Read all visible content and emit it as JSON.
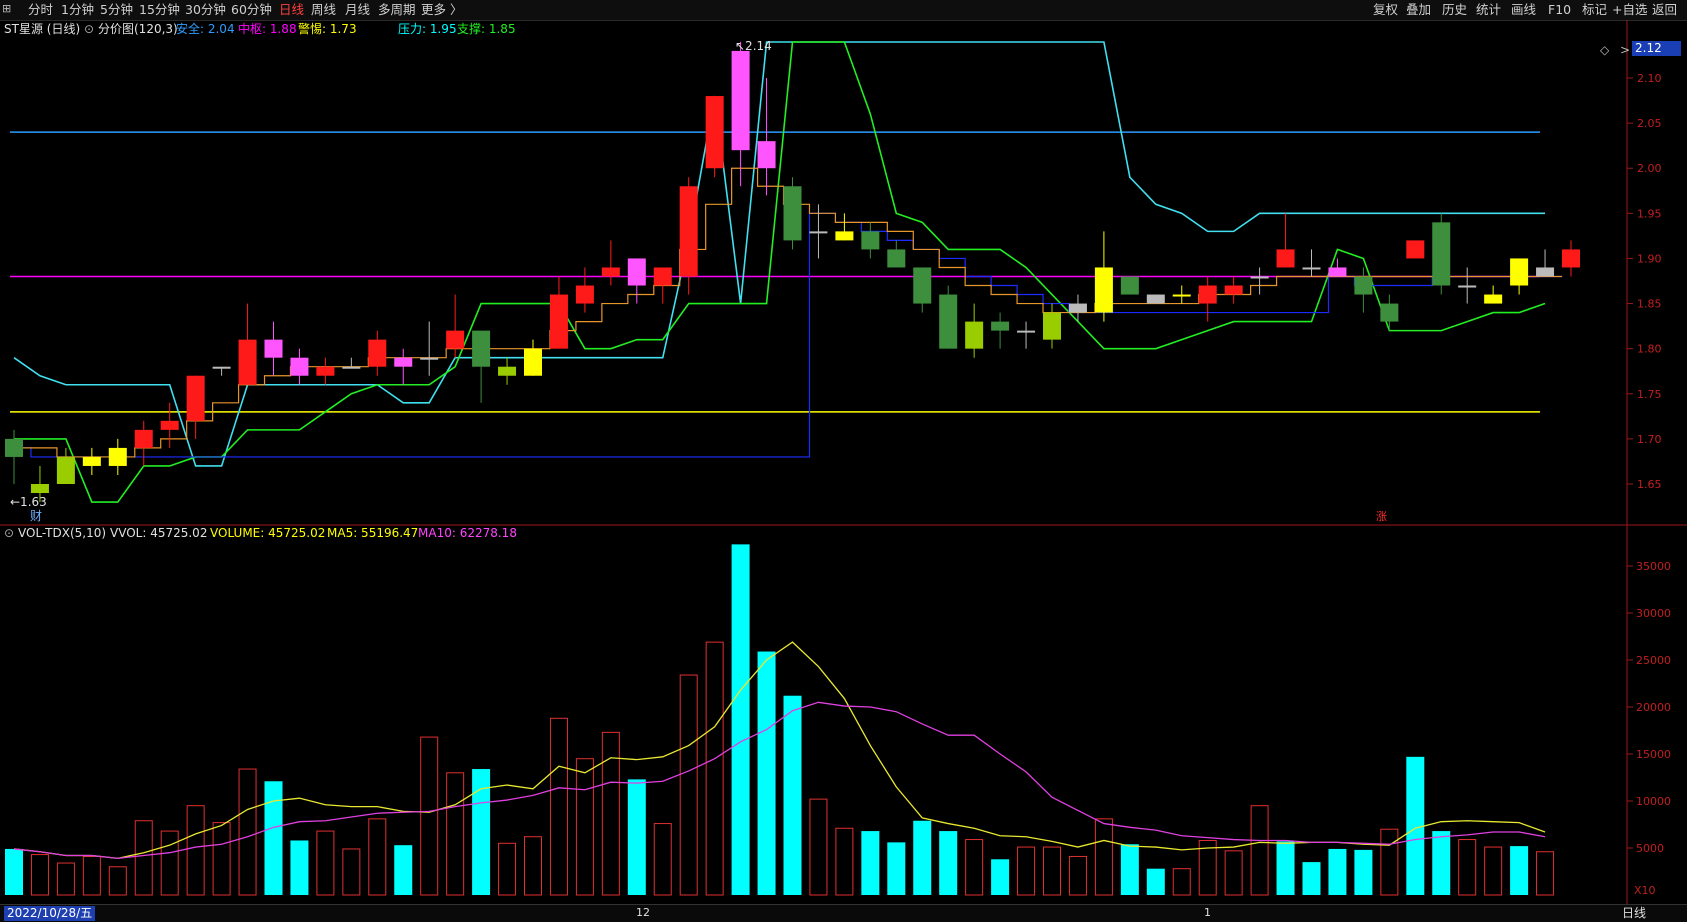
{
  "toolbar": {
    "periods": [
      {
        "label": "分时",
        "x": 0
      },
      {
        "label": "1分钟",
        "x": 0
      },
      {
        "label": "5分钟",
        "x": 0
      },
      {
        "label": "15分钟",
        "x": 0
      },
      {
        "label": "30分钟",
        "x": 0
      },
      {
        "label": "60分钟",
        "x": 0
      },
      {
        "label": "日线",
        "x": 0
      },
      {
        "label": "周线",
        "x": 0
      },
      {
        "label": "月线",
        "x": 0
      },
      {
        "label": "多周期",
        "x": 0
      },
      {
        "label": "更多 〉",
        "x": 0
      }
    ],
    "active_period": "日线",
    "actions": [
      "复权",
      "叠加",
      "历史",
      "统计",
      "画线",
      "F10",
      "标记",
      "+自选",
      "返回"
    ]
  },
  "main_info": {
    "stock_name": "ST星源 (日线)",
    "indicator": "分价图(120,3)",
    "safe_label": "安全: 2.04",
    "pivot_label": "中枢: 1.88",
    "alert_label": "警惕: 1.73",
    "pressure_label": "压力: 1.95",
    "support_label": "支撑: 1.85",
    "price_badge": "2.12",
    "high_marker": "2.14",
    "low_marker": "1.63",
    "cai_marker": "财",
    "zhang_marker": "涨"
  },
  "volume_info": {
    "indicator": "VOL-TDX(5,10)",
    "vvol": "VVOL: 45725.02",
    "volume": "VOLUME: 45725.02",
    "ma5": "MA5: 55196.47",
    "ma10": "MA10: 62278.18",
    "x10": "X10"
  },
  "bottom": {
    "date_label": "2022/10/28/五",
    "month_12": "12",
    "month_1": "1",
    "timeframe": "日线"
  },
  "colors": {
    "up": "#ff2020",
    "down": "#3a8a3a",
    "cyan": "#00ffff",
    "magenta": "#ff44ff",
    "yellow": "#ffff00",
    "safe_line": "#2e9bff",
    "pivot_line": "#ff00ff",
    "alert_line": "#ffff00"
  },
  "chart_data": {
    "type": "candlestick",
    "y_axis_ticks": [
      "2.10",
      "2.05",
      "2.00",
      "1.95",
      "1.90",
      "1.85",
      "1.80",
      "1.75",
      "1.70",
      "1.65"
    ],
    "volume_axis_ticks": [
      "35000",
      "30000",
      "25000",
      "20000",
      "15000",
      "10000",
      "5000"
    ],
    "levels": {
      "safe": 2.04,
      "pivot": 1.88,
      "alert": 1.73,
      "pressure": 1.95,
      "support": 1.85
    },
    "candles": [
      {
        "o": 1.7,
        "h": 1.71,
        "l": 1.65,
        "c": 1.68,
        "col": "darkgreen"
      },
      {
        "o": 1.65,
        "h": 1.67,
        "l": 1.63,
        "c": 1.64,
        "col": "lime"
      },
      {
        "o": 1.68,
        "h": 1.69,
        "l": 1.65,
        "c": 1.65,
        "col": "lime"
      },
      {
        "o": 1.67,
        "h": 1.69,
        "l": 1.66,
        "c": 1.68,
        "col": "yellow"
      },
      {
        "o": 1.69,
        "h": 1.7,
        "l": 1.66,
        "c": 1.67,
        "col": "yellow"
      },
      {
        "o": 1.69,
        "h": 1.72,
        "l": 1.67,
        "c": 1.71,
        "col": "red"
      },
      {
        "o": 1.71,
        "h": 1.74,
        "l": 1.69,
        "c": 1.72,
        "col": "red"
      },
      {
        "o": 1.72,
        "h": 1.77,
        "l": 1.7,
        "c": 1.77,
        "col": "red"
      },
      {
        "o": 1.78,
        "h": 1.78,
        "l": 1.77,
        "c": 1.78,
        "col": "gray"
      },
      {
        "o": 1.76,
        "h": 1.85,
        "l": 1.76,
        "c": 1.81,
        "col": "red"
      },
      {
        "o": 1.81,
        "h": 1.83,
        "l": 1.77,
        "c": 1.79,
        "col": "magenta"
      },
      {
        "o": 1.77,
        "h": 1.8,
        "l": 1.76,
        "c": 1.79,
        "col": "magenta"
      },
      {
        "o": 1.78,
        "h": 1.79,
        "l": 1.76,
        "c": 1.77,
        "col": "red"
      },
      {
        "o": 1.78,
        "h": 1.79,
        "l": 1.78,
        "c": 1.78,
        "col": "gray"
      },
      {
        "o": 1.78,
        "h": 1.82,
        "l": 1.77,
        "c": 1.81,
        "col": "red"
      },
      {
        "o": 1.79,
        "h": 1.8,
        "l": 1.76,
        "c": 1.78,
        "col": "magenta"
      },
      {
        "o": 1.79,
        "h": 1.83,
        "l": 1.77,
        "c": 1.79,
        "col": "gray"
      },
      {
        "o": 1.8,
        "h": 1.86,
        "l": 1.79,
        "c": 1.82,
        "col": "red"
      },
      {
        "o": 1.82,
        "h": 1.81,
        "l": 1.74,
        "c": 1.78,
        "col": "darkgreen"
      },
      {
        "o": 1.77,
        "h": 1.79,
        "l": 1.76,
        "c": 1.78,
        "col": "lime"
      },
      {
        "o": 1.77,
        "h": 1.81,
        "l": 1.77,
        "c": 1.8,
        "col": "yellow"
      },
      {
        "o": 1.8,
        "h": 1.88,
        "l": 1.8,
        "c": 1.86,
        "col": "red"
      },
      {
        "o": 1.85,
        "h": 1.89,
        "l": 1.84,
        "c": 1.87,
        "col": "red"
      },
      {
        "o": 1.88,
        "h": 1.92,
        "l": 1.87,
        "c": 1.89,
        "col": "red"
      },
      {
        "o": 1.87,
        "h": 1.9,
        "l": 1.85,
        "c": 1.9,
        "col": "magenta"
      },
      {
        "o": 1.87,
        "h": 1.89,
        "l": 1.85,
        "c": 1.89,
        "col": "red"
      },
      {
        "o": 1.88,
        "h": 1.99,
        "l": 1.86,
        "c": 1.98,
        "col": "red"
      },
      {
        "o": 2.0,
        "h": 2.08,
        "l": 1.99,
        "c": 2.08,
        "col": "red"
      },
      {
        "o": 2.02,
        "h": 2.14,
        "l": 1.98,
        "c": 2.13,
        "col": "magenta"
      },
      {
        "o": 2.03,
        "h": 2.1,
        "l": 1.97,
        "c": 2.0,
        "col": "magenta"
      },
      {
        "o": 1.98,
        "h": 1.99,
        "l": 1.91,
        "c": 1.92,
        "col": "darkgreen"
      },
      {
        "o": 1.93,
        "h": 1.96,
        "l": 1.9,
        "c": 1.93,
        "col": "gray"
      },
      {
        "o": 1.93,
        "h": 1.95,
        "l": 1.92,
        "c": 1.92,
        "col": "yellow"
      },
      {
        "o": 1.93,
        "h": 1.94,
        "l": 1.9,
        "c": 1.91,
        "col": "darkgreen"
      },
      {
        "o": 1.91,
        "h": 1.92,
        "l": 1.89,
        "c": 1.89,
        "col": "darkgreen"
      },
      {
        "o": 1.89,
        "h": 1.89,
        "l": 1.84,
        "c": 1.85,
        "col": "darkgreen"
      },
      {
        "o": 1.86,
        "h": 1.87,
        "l": 1.8,
        "c": 1.8,
        "col": "darkgreen"
      },
      {
        "o": 1.83,
        "h": 1.85,
        "l": 1.79,
        "c": 1.8,
        "col": "lime"
      },
      {
        "o": 1.83,
        "h": 1.84,
        "l": 1.8,
        "c": 1.82,
        "col": "darkgreen"
      },
      {
        "o": 1.82,
        "h": 1.83,
        "l": 1.8,
        "c": 1.82,
        "col": "gray"
      },
      {
        "o": 1.81,
        "h": 1.85,
        "l": 1.8,
        "c": 1.84,
        "col": "lime"
      },
      {
        "o": 1.84,
        "h": 1.86,
        "l": 1.83,
        "c": 1.85,
        "col": "gray"
      },
      {
        "o": 1.89,
        "h": 1.93,
        "l": 1.83,
        "c": 1.84,
        "col": "yellow"
      },
      {
        "o": 1.88,
        "h": 1.88,
        "l": 1.86,
        "c": 1.86,
        "col": "darkgreen"
      },
      {
        "o": 1.86,
        "h": 1.86,
        "l": 1.85,
        "c": 1.85,
        "col": "gray"
      },
      {
        "o": 1.86,
        "h": 1.87,
        "l": 1.85,
        "c": 1.86,
        "col": "yellow"
      },
      {
        "o": 1.85,
        "h": 1.88,
        "l": 1.83,
        "c": 1.87,
        "col": "red"
      },
      {
        "o": 1.86,
        "h": 1.88,
        "l": 1.85,
        "c": 1.87,
        "col": "red"
      },
      {
        "o": 1.88,
        "h": 1.89,
        "l": 1.86,
        "c": 1.88,
        "col": "gray"
      },
      {
        "o": 1.89,
        "h": 1.95,
        "l": 1.89,
        "c": 1.91,
        "col": "red"
      },
      {
        "o": 1.89,
        "h": 1.91,
        "l": 1.88,
        "c": 1.89,
        "col": "gray"
      },
      {
        "o": 1.88,
        "h": 1.9,
        "l": 1.88,
        "c": 1.89,
        "col": "magenta"
      },
      {
        "o": 1.88,
        "h": 1.89,
        "l": 1.84,
        "c": 1.86,
        "col": "darkgreen"
      },
      {
        "o": 1.85,
        "h": 1.86,
        "l": 1.82,
        "c": 1.83,
        "col": "darkgreen"
      },
      {
        "o": 1.9,
        "h": 1.92,
        "l": 1.9,
        "c": 1.92,
        "col": "red"
      },
      {
        "o": 1.94,
        "h": 1.95,
        "l": 1.86,
        "c": 1.87,
        "col": "darkgreen"
      },
      {
        "o": 1.87,
        "h": 1.89,
        "l": 1.85,
        "c": 1.87,
        "col": "gray"
      },
      {
        "o": 1.86,
        "h": 1.87,
        "l": 1.85,
        "c": 1.85,
        "col": "yellow"
      },
      {
        "o": 1.87,
        "h": 1.9,
        "l": 1.86,
        "c": 1.9,
        "col": "yellow"
      },
      {
        "o": 1.88,
        "h": 1.91,
        "l": 1.88,
        "c": 1.89,
        "col": "gray"
      },
      {
        "o": 1.89,
        "h": 1.92,
        "l": 1.88,
        "c": 1.91,
        "col": "red"
      }
    ],
    "volumes": [
      {
        "v": 4900,
        "filled": true
      },
      {
        "v": 4300,
        "filled": false
      },
      {
        "v": 3400,
        "filled": false
      },
      {
        "v": 4100,
        "filled": false
      },
      {
        "v": 3000,
        "filled": false
      },
      {
        "v": 7900,
        "filled": false
      },
      {
        "v": 6800,
        "filled": false
      },
      {
        "v": 9500,
        "filled": false
      },
      {
        "v": 7700,
        "filled": false
      },
      {
        "v": 13400,
        "filled": false
      },
      {
        "v": 12100,
        "filled": true
      },
      {
        "v": 5800,
        "filled": true
      },
      {
        "v": 6800,
        "filled": false
      },
      {
        "v": 4900,
        "filled": false
      },
      {
        "v": 8100,
        "filled": false
      },
      {
        "v": 5300,
        "filled": true
      },
      {
        "v": 16800,
        "filled": false
      },
      {
        "v": 13000,
        "filled": false
      },
      {
        "v": 13400,
        "filled": true
      },
      {
        "v": 5500,
        "filled": false
      },
      {
        "v": 6200,
        "filled": false
      },
      {
        "v": 18800,
        "filled": false
      },
      {
        "v": 14500,
        "filled": false
      },
      {
        "v": 17300,
        "filled": false
      },
      {
        "v": 12300,
        "filled": true
      },
      {
        "v": 7600,
        "filled": false
      },
      {
        "v": 23400,
        "filled": false
      },
      {
        "v": 26900,
        "filled": false
      },
      {
        "v": 37300,
        "filled": true
      },
      {
        "v": 25900,
        "filled": true
      },
      {
        "v": 21200,
        "filled": true
      },
      {
        "v": 10200,
        "filled": false
      },
      {
        "v": 7100,
        "filled": false
      },
      {
        "v": 6800,
        "filled": true
      },
      {
        "v": 5600,
        "filled": true
      },
      {
        "v": 7900,
        "filled": true
      },
      {
        "v": 6800,
        "filled": true
      },
      {
        "v": 5900,
        "filled": false
      },
      {
        "v": 3800,
        "filled": true
      },
      {
        "v": 5100,
        "filled": false
      },
      {
        "v": 5100,
        "filled": false
      },
      {
        "v": 4100,
        "filled": false
      },
      {
        "v": 8100,
        "filled": false
      },
      {
        "v": 5400,
        "filled": true
      },
      {
        "v": 2800,
        "filled": true
      },
      {
        "v": 2800,
        "filled": false
      },
      {
        "v": 5800,
        "filled": false
      },
      {
        "v": 4700,
        "filled": false
      },
      {
        "v": 9500,
        "filled": false
      },
      {
        "v": 5700,
        "filled": true
      },
      {
        "v": 3500,
        "filled": true
      },
      {
        "v": 4900,
        "filled": true
      },
      {
        "v": 4800,
        "filled": true
      },
      {
        "v": 7000,
        "filled": false
      },
      {
        "v": 14700,
        "filled": true
      },
      {
        "v": 6800,
        "filled": true
      },
      {
        "v": 5900,
        "filled": false
      },
      {
        "v": 5100,
        "filled": false
      },
      {
        "v": 5200,
        "filled": true
      },
      {
        "v": 4600,
        "filled": false
      }
    ],
    "ma5_volume": [
      4900,
      4600,
      4200,
      4200,
      3900,
      4500,
      5300,
      6500,
      7400,
      9100,
      10000,
      10300,
      9600,
      9400,
      9400,
      8900,
      8800,
      9600,
      11300,
      11700,
      11300,
      13700,
      13000,
      14600,
      14400,
      14700,
      15900,
      17900,
      21800,
      25000,
      26900,
      24300,
      20900,
      15900,
      11500,
      8200,
      7600,
      7100,
      6300,
      6200,
      5700,
      5100,
      5800,
      5200,
      5100,
      4800,
      5000,
      5100,
      5600,
      5500,
      5600,
      5600,
      5400,
      5300,
      7100,
      7800,
      7900,
      7800,
      7700,
      6700
    ],
    "ma10_volume": [
      4900,
      4600,
      4200,
      4200,
      3900,
      4200,
      4500,
      5100,
      5400,
      6200,
      7200,
      7800,
      7900,
      8300,
      8700,
      8800,
      8900,
      9400,
      9800,
      10100,
      10600,
      11400,
      11200,
      12000,
      11900,
      12100,
      13200,
      14500,
      16300,
      17600,
      19600,
      20500,
      20100,
      20000,
      19500,
      18200,
      17000,
      17000,
      15000,
      13100,
      10400,
      9000,
      7600,
      7200,
      6900,
      6300,
      6100,
      5900,
      5800,
      5800,
      5600,
      5600,
      5500,
      5400,
      5900,
      6200,
      6400,
      6700,
      6700,
      6200
    ],
    "upper_line": [
      1.79,
      1.77,
      1.76,
      1.76,
      1.76,
      1.76,
      1.76,
      1.67,
      1.67,
      1.76,
      1.76,
      1.76,
      1.76,
      1.76,
      1.76,
      1.74,
      1.74,
      1.79,
      1.79,
      1.79,
      1.79,
      1.79,
      1.79,
      1.79,
      1.79,
      1.79,
      1.92,
      2.08,
      1.85,
      2.23,
      2.23,
      2.23,
      2.23,
      2.23,
      2.23,
      2.23,
      2.23,
      2.23,
      2.23,
      2.23,
      2.23,
      2.23,
      2.17,
      1.99,
      1.96,
      1.95,
      1.93,
      1.93,
      1.95,
      1.95,
      1.95,
      1.95,
      1.95,
      1.95,
      1.95,
      1.95,
      1.95,
      1.95,
      1.95,
      1.95
    ],
    "lower_line": [
      1.7,
      1.7,
      1.7,
      1.63,
      1.63,
      1.67,
      1.67,
      1.68,
      1.68,
      1.71,
      1.71,
      1.71,
      1.73,
      1.75,
      1.76,
      1.76,
      1.76,
      1.78,
      1.85,
      1.85,
      1.85,
      1.85,
      1.8,
      1.8,
      1.81,
      1.81,
      1.85,
      1.85,
      1.85,
      1.85,
      2.23,
      2.23,
      2.23,
      2.06,
      1.95,
      1.94,
      1.91,
      1.91,
      1.91,
      1.89,
      1.86,
      1.83,
      1.8,
      1.8,
      1.8,
      1.81,
      1.82,
      1.83,
      1.83,
      1.83,
      1.83,
      1.91,
      1.9,
      1.82,
      1.82,
      1.82,
      1.83,
      1.84,
      1.84,
      1.85
    ],
    "step_line": [
      1.69,
      1.69,
      1.68,
      1.68,
      1.68,
      1.69,
      1.7,
      1.72,
      1.74,
      1.76,
      1.77,
      1.78,
      1.78,
      1.78,
      1.79,
      1.79,
      1.79,
      1.8,
      1.8,
      1.8,
      1.8,
      1.82,
      1.83,
      1.85,
      1.86,
      1.87,
      1.91,
      1.96,
      2.0,
      1.98,
      1.96,
      1.95,
      1.94,
      1.94,
      1.93,
      1.91,
      1.89,
      1.87,
      1.86,
      1.85,
      1.84,
      1.84,
      1.85,
      1.85,
      1.85,
      1.85,
      1.86,
      1.86,
      1.87,
      1.88,
      1.88,
      1.88,
      1.88,
      1.88,
      1.88,
      1.88,
      1.88,
      1.88,
      1.88,
      1.88
    ],
    "blue_step": [
      1.69,
      1.68,
      1.68,
      1.68,
      1.68,
      1.68,
      1.68,
      1.68,
      1.68,
      1.68,
      1.68,
      1.68,
      1.68,
      1.68,
      1.68,
      1.68,
      1.68,
      1.68,
      1.68,
      1.68,
      1.68,
      1.68,
      1.68,
      1.68,
      1.68,
      1.68,
      1.68,
      1.68,
      1.68,
      1.68,
      1.68,
      1.95,
      1.94,
      1.93,
      1.92,
      1.91,
      1.9,
      1.88,
      1.87,
      1.86,
      1.85,
      1.84,
      1.84,
      1.84,
      1.84,
      1.84,
      1.84,
      1.84,
      1.84,
      1.84,
      1.84,
      1.88,
      1.87,
      1.87,
      1.87,
      1.88,
      1.88,
      1.88,
      1.88,
      1.88
    ]
  }
}
